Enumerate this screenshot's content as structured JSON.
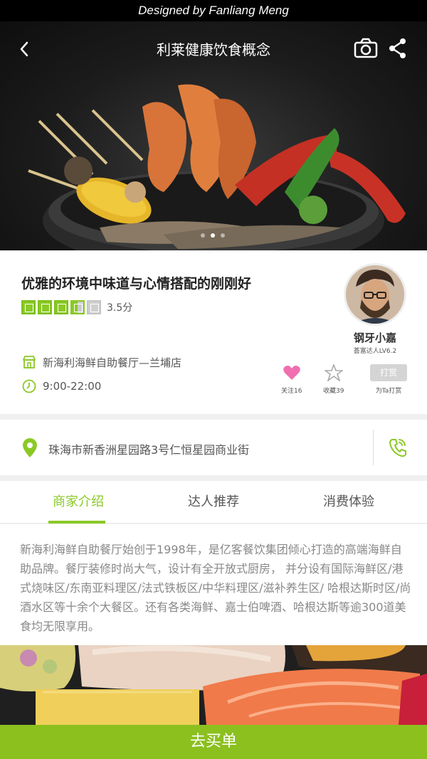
{
  "designer_credit": "Designed by Fanliang Meng",
  "nav": {
    "title": "利莱健康饮食概念",
    "back_icon": "chevron-left-icon",
    "camera_icon": "camera-icon",
    "share_icon": "share-icon"
  },
  "carousel": {
    "slide_count": 3,
    "active_index": 1
  },
  "shop": {
    "headline": "优雅的环境中味道与心情搭配的刚刚好",
    "rating_score": 3.5,
    "rating_text": "3.5分",
    "store_name": "新海利海鲜自助餐厅—兰埔店",
    "hours": "9:00-22:00"
  },
  "author": {
    "name": "钢牙小嘉",
    "level": "荟富达人LV6.2"
  },
  "actions": {
    "follow_label": "关注16",
    "favorite_label": "收藏39",
    "tip_button": "打赏",
    "tip_label": "为Ta打赏"
  },
  "address": {
    "text": "珠海市新香洲星园路3号仁恒星园商业街"
  },
  "tabs": [
    {
      "label": "商家介绍",
      "active": true
    },
    {
      "label": "达人推荐",
      "active": false
    },
    {
      "label": "消费体验",
      "active": false
    }
  ],
  "intro": "新海利海鲜自助餐厅始创于1998年，是亿客餐饮集团倾心打造的高端海鲜自助品牌。餐厅装修时尚大气，设计有全开放式厨房， 并分设有国际海鲜区/港式烧味区/东南亚料理区/法式铁板区/中华料理区/滋补养生区/ 哈根达斯时区/尚酒水区等十余个大餐区。还有各类海鲜、嘉士伯啤酒、哈根达斯等逾300道美食均无限享用。",
  "buy_button": "去买单",
  "colors": {
    "accent": "#8bc926",
    "buy_bar": "#8bc01f",
    "heart": "#f06fb0"
  }
}
